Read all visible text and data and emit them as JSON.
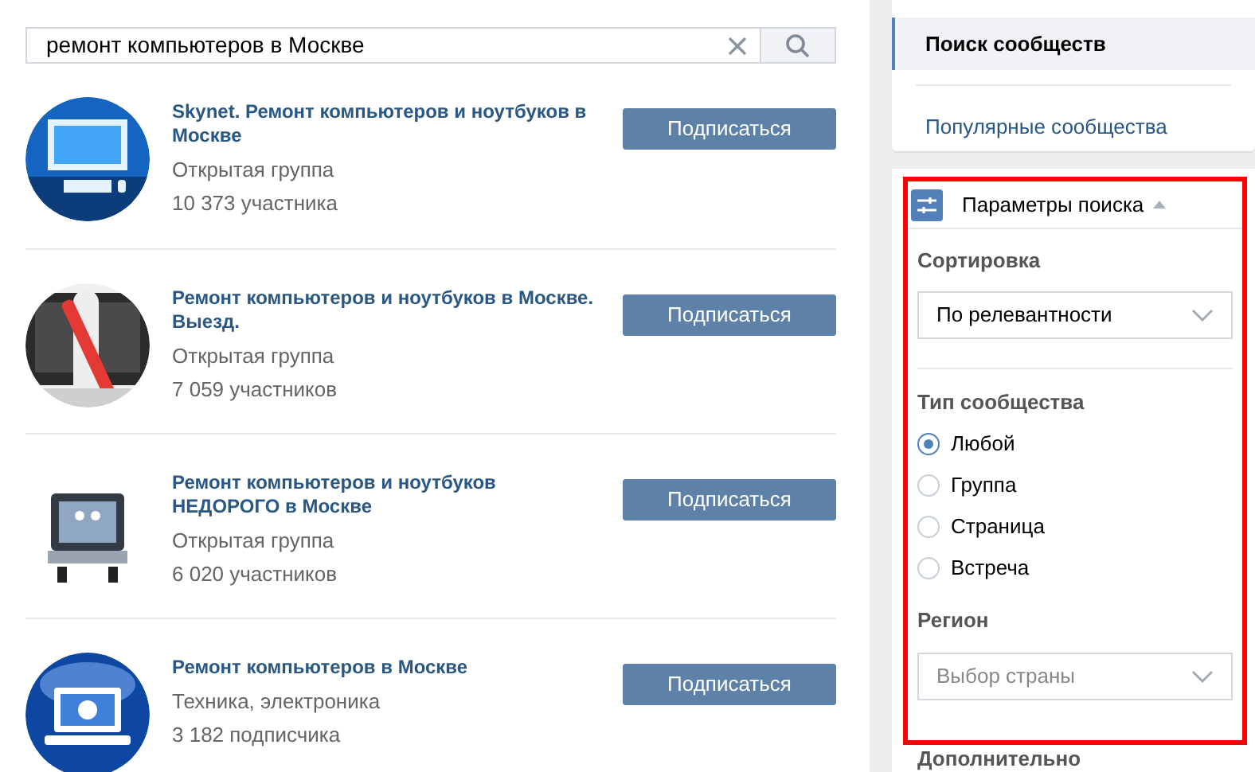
{
  "search": {
    "value": "ремонт компьютеров в Москве"
  },
  "results": [
    {
      "title": "Skynet. Ремонт компьютеров и ноутбуков в Москве",
      "category": "Открытая группа",
      "members": "10 373 участника",
      "button": "Подписаться"
    },
    {
      "title": "Ремонт компьютеров и ноутбуков в Москве. Выезд.",
      "category": "Открытая группа",
      "members": "7 059 участников",
      "button": "Подписаться"
    },
    {
      "title": "Ремонт компьютеров и ноутбуков НЕДОРОГО в Москве",
      "category": "Открытая группа",
      "members": "6 020 участников",
      "button": "Подписаться"
    },
    {
      "title": "Ремонт компьютеров в Москве",
      "category": "Техника, электроника",
      "members": "3 182 подписчика",
      "button": "Подписаться"
    }
  ],
  "nav": [
    {
      "label": "Поиск сообществ",
      "selected": true
    },
    {
      "label": "Популярные сообщества",
      "selected": false
    }
  ],
  "filters": {
    "title": "Параметры поиска",
    "expanded": true,
    "highlighted": true,
    "sort": {
      "label": "Сортировка",
      "value": "По релевантности"
    },
    "type": {
      "label": "Тип сообщества",
      "options": [
        {
          "label": "Любой",
          "selected": true
        },
        {
          "label": "Группа",
          "selected": false
        },
        {
          "label": "Страница",
          "selected": false
        },
        {
          "label": "Встреча",
          "selected": false
        }
      ]
    },
    "region": {
      "label": "Регион",
      "placeholder": "Выбор страны"
    },
    "more": "Дополнительно"
  }
}
